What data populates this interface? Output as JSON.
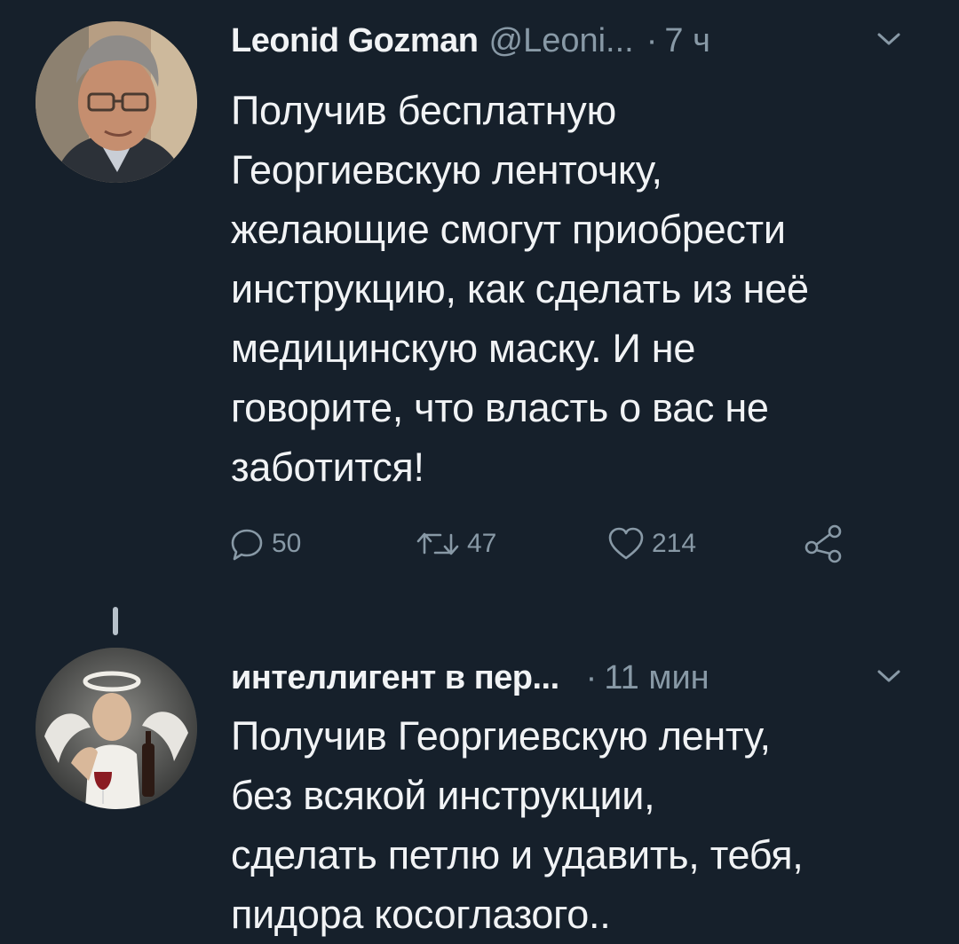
{
  "tweets": [
    {
      "name": "Leonid Gozman",
      "handle": "@Leoni...",
      "separator": "·",
      "time": "7 ч",
      "text": "Получив бесплатную\nГеоргиевскую ленточку,\nжелающие смогут приобрести\nинструкцию, как сделать из неё\nмедицинскую маску. И не\nговорите, что власть о вас не\nзаботится!",
      "replies": "50",
      "retweets": "47",
      "likes": "214",
      "icons": [
        "reply-icon",
        "retweet-icon",
        "like-icon",
        "share-icon",
        "chevron-down-icon"
      ]
    },
    {
      "name": "интеллигент в пер...",
      "separator": "·",
      "time": "11 мин",
      "text": "Получив Георгиевскую ленту,\nбез всякой инструкции,\nсделать петлю и удавить, тебя,\nпидора косоглазого.."
    }
  ],
  "colors": {
    "background": "#16202b",
    "primary_text": "#f1f3f5",
    "secondary_text": "#8899a6"
  }
}
